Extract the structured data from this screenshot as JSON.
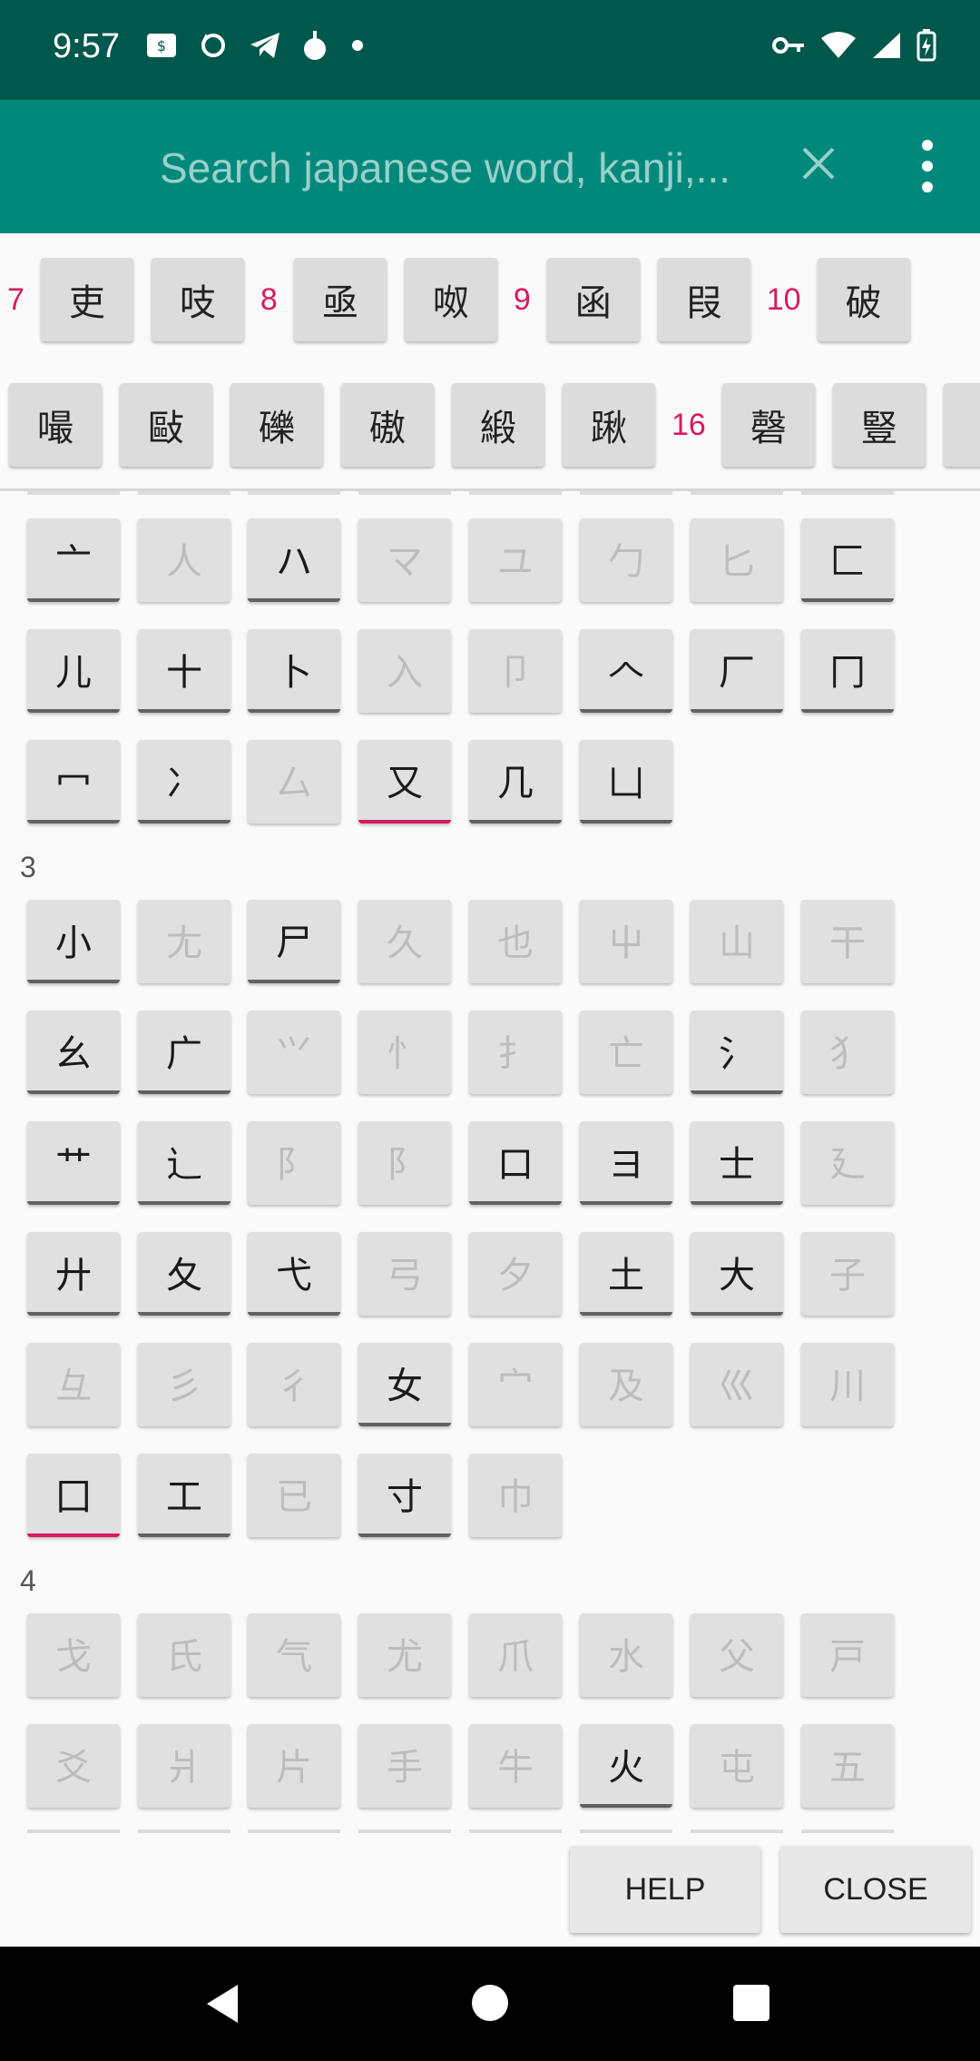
{
  "status_bar": {
    "time": "9:57",
    "left_icons": [
      "sim-card-icon",
      "sync-icon",
      "telegram-icon",
      "app-icon",
      "dot-icon"
    ],
    "right_icons": [
      "vpn-key-icon",
      "wifi-icon",
      "signal-icon",
      "battery-charging-icon"
    ]
  },
  "toolbar": {
    "search_placeholder": "Search japanese word, kanji,...",
    "clear_icon": "close-icon",
    "menu_icon": "more-vert-icon"
  },
  "results": {
    "row1": [
      {
        "type": "count",
        "text": "7"
      },
      {
        "type": "kanji",
        "text": "吏"
      },
      {
        "type": "kanji",
        "text": "吱"
      },
      {
        "type": "count",
        "text": "8"
      },
      {
        "type": "kanji",
        "text": "亟"
      },
      {
        "type": "kanji",
        "text": "呶"
      },
      {
        "type": "count",
        "text": "9"
      },
      {
        "type": "kanji",
        "text": "函"
      },
      {
        "type": "kanji",
        "text": "叚"
      },
      {
        "type": "count",
        "text": "10"
      },
      {
        "type": "kanji",
        "text": "破"
      }
    ],
    "row2": [
      {
        "type": "kanji",
        "text": "嘬"
      },
      {
        "type": "kanji",
        "text": "敺"
      },
      {
        "type": "kanji",
        "text": "礫"
      },
      {
        "type": "kanji",
        "text": "磝"
      },
      {
        "type": "kanji",
        "text": "緞"
      },
      {
        "type": "kanji",
        "text": "踿"
      },
      {
        "type": "count",
        "text": "16"
      },
      {
        "type": "kanji",
        "text": "磬"
      },
      {
        "type": "kanji",
        "text": "豎"
      },
      {
        "type": "kanji",
        "text": ""
      }
    ]
  },
  "radical_groups": [
    {
      "label": "",
      "rows": [
        [
          {
            "t": "亠",
            "s": "en"
          },
          {
            "t": "人",
            "s": "dis"
          },
          {
            "t": "ハ",
            "s": "en"
          },
          {
            "t": "マ",
            "s": "dis"
          },
          {
            "t": "ユ",
            "s": "dis"
          },
          {
            "t": "勹",
            "s": "dis"
          },
          {
            "t": "匕",
            "s": "dis"
          },
          {
            "t": "匚",
            "s": "en"
          }
        ],
        [
          {
            "t": "儿",
            "s": "en"
          },
          {
            "t": "十",
            "s": "en"
          },
          {
            "t": "卜",
            "s": "en"
          },
          {
            "t": "入",
            "s": "dis"
          },
          {
            "t": "卩",
            "s": "dis"
          },
          {
            "t": "𠆢",
            "s": "en"
          },
          {
            "t": "厂",
            "s": "en"
          },
          {
            "t": "冂",
            "s": "en"
          }
        ],
        [
          {
            "t": "冖",
            "s": "en"
          },
          {
            "t": "冫",
            "s": "en"
          },
          {
            "t": "厶",
            "s": "dis"
          },
          {
            "t": "又",
            "s": "sel"
          },
          {
            "t": "几",
            "s": "en"
          },
          {
            "t": "凵",
            "s": "en"
          }
        ]
      ]
    },
    {
      "label": "3",
      "rows": [
        [
          {
            "t": "小",
            "s": "en"
          },
          {
            "t": "尢",
            "s": "dis"
          },
          {
            "t": "尸",
            "s": "en"
          },
          {
            "t": "久",
            "s": "dis"
          },
          {
            "t": "也",
            "s": "dis"
          },
          {
            "t": "屮",
            "s": "dis"
          },
          {
            "t": "山",
            "s": "dis"
          },
          {
            "t": "干",
            "s": "dis"
          }
        ],
        [
          {
            "t": "幺",
            "s": "en"
          },
          {
            "t": "广",
            "s": "en"
          },
          {
            "t": "⺍",
            "s": "dis"
          },
          {
            "t": "忄",
            "s": "dis"
          },
          {
            "t": "扌",
            "s": "dis"
          },
          {
            "t": "亡",
            "s": "dis"
          },
          {
            "t": "氵",
            "s": "en"
          },
          {
            "t": "犭",
            "s": "dis"
          }
        ],
        [
          {
            "t": "艹",
            "s": "en"
          },
          {
            "t": "辶",
            "s": "en"
          },
          {
            "t": "阝",
            "s": "dis"
          },
          {
            "t": "阝",
            "s": "dis"
          },
          {
            "t": "口",
            "s": "en"
          },
          {
            "t": "ヨ",
            "s": "en"
          },
          {
            "t": "士",
            "s": "en"
          },
          {
            "t": "廴",
            "s": "dis"
          }
        ],
        [
          {
            "t": "廾",
            "s": "en"
          },
          {
            "t": "夂",
            "s": "en"
          },
          {
            "t": "弋",
            "s": "en"
          },
          {
            "t": "弓",
            "s": "dis"
          },
          {
            "t": "夕",
            "s": "dis"
          },
          {
            "t": "土",
            "s": "en"
          },
          {
            "t": "大",
            "s": "en"
          },
          {
            "t": "子",
            "s": "dis"
          }
        ],
        [
          {
            "t": "彑",
            "s": "dis"
          },
          {
            "t": "彡",
            "s": "dis"
          },
          {
            "t": "彳",
            "s": "dis"
          },
          {
            "t": "女",
            "s": "en"
          },
          {
            "t": "宀",
            "s": "dis"
          },
          {
            "t": "及",
            "s": "dis"
          },
          {
            "t": "巛",
            "s": "dis"
          },
          {
            "t": "川",
            "s": "dis"
          }
        ],
        [
          {
            "t": "囗",
            "s": "sel"
          },
          {
            "t": "工",
            "s": "en"
          },
          {
            "t": "已",
            "s": "dis"
          },
          {
            "t": "寸",
            "s": "en"
          },
          {
            "t": "巾",
            "s": "dis"
          }
        ]
      ]
    },
    {
      "label": "4",
      "rows": [
        [
          {
            "t": "戈",
            "s": "dis"
          },
          {
            "t": "氏",
            "s": "dis"
          },
          {
            "t": "气",
            "s": "dis"
          },
          {
            "t": "尤",
            "s": "dis"
          },
          {
            "t": "爪",
            "s": "dis"
          },
          {
            "t": "水",
            "s": "dis"
          },
          {
            "t": "父",
            "s": "dis"
          },
          {
            "t": "戸",
            "s": "dis"
          }
        ],
        [
          {
            "t": "爻",
            "s": "dis"
          },
          {
            "t": "爿",
            "s": "dis"
          },
          {
            "t": "片",
            "s": "dis"
          },
          {
            "t": "手",
            "s": "dis"
          },
          {
            "t": "牛",
            "s": "dis"
          },
          {
            "t": "火",
            "s": "en"
          },
          {
            "t": "屯",
            "s": "dis"
          },
          {
            "t": "五",
            "s": "dis"
          }
        ]
      ]
    }
  ],
  "actions": {
    "help_label": "HELP",
    "close_label": "CLOSE"
  },
  "nav_bar": {
    "icons": [
      "back-icon",
      "home-icon",
      "recents-icon"
    ]
  },
  "colors": {
    "status_bar": "#00574b",
    "toolbar": "#00897b",
    "accent": "#d81b60"
  }
}
